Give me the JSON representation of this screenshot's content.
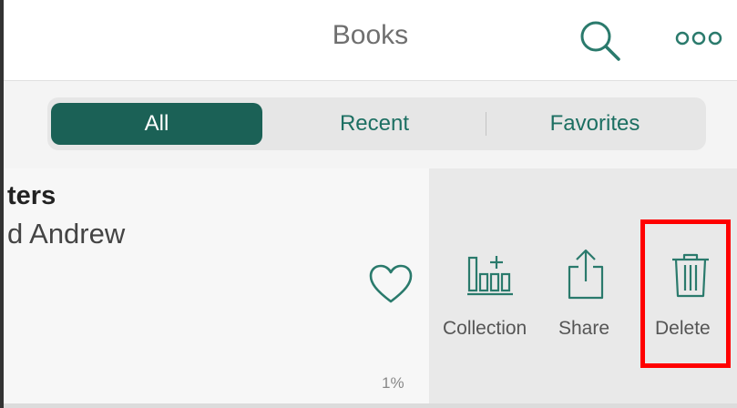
{
  "header": {
    "title": "Books"
  },
  "segments": {
    "all": "All",
    "recent": "Recent",
    "favorites": "Favorites"
  },
  "book": {
    "title_fragment": "ters",
    "author_fragment": "d Andrew",
    "progress": "1%"
  },
  "actions": {
    "collection": "Collection",
    "share": "Share",
    "delete": "Delete"
  },
  "colors": {
    "accent": "#1b6156",
    "icon": "#2a7a6c",
    "highlight": "#ff0000"
  },
  "icons": [
    "search-icon",
    "more-icon",
    "heart-icon",
    "collection-icon",
    "share-icon",
    "trash-icon"
  ]
}
